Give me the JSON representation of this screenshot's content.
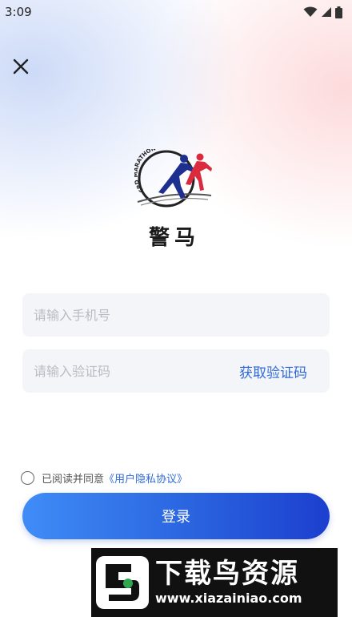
{
  "status_bar": {
    "time": "3:09",
    "icons": [
      "wifi-icon",
      "signal-icon",
      "battery-icon"
    ]
  },
  "header": {
    "close_icon": "close-icon"
  },
  "logo": {
    "ring_text": "CPD MARATHON",
    "name": "警马"
  },
  "form": {
    "phone_placeholder": "请输入手机号",
    "phone_value": "",
    "code_placeholder": "请输入验证码",
    "code_value": "",
    "get_code_label": "获取验证码"
  },
  "agreement": {
    "checked": false,
    "prefix": "已阅读并同意",
    "link": "《用户隐私协议》"
  },
  "login": {
    "label": "登录"
  },
  "watermark": {
    "title": "下载鸟资源",
    "url": "www.xiazainiao.com"
  },
  "colors": {
    "accent": "#2f6ad9",
    "button_gradient_start": "#3f8cf7",
    "button_gradient_end": "#1c3fcf",
    "field_bg": "#f4f5f8"
  }
}
